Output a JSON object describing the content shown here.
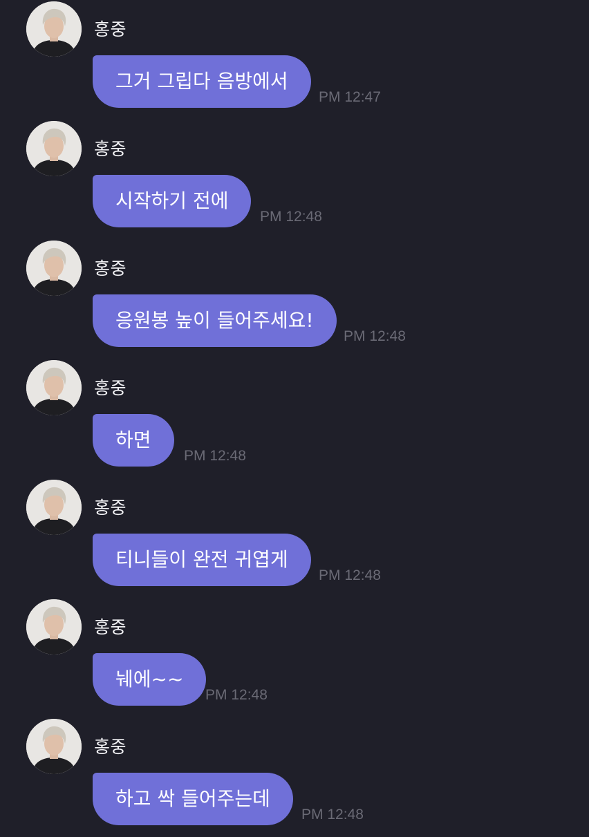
{
  "messages": [
    {
      "sender": "홍중",
      "text": "그거 그립다 음방에서",
      "time": "PM 12:47"
    },
    {
      "sender": "홍중",
      "text": "시작하기 전에",
      "time": "PM 12:48"
    },
    {
      "sender": "홍중",
      "text": "응원봉 높이 들어주세요!",
      "time": "PM 12:48"
    },
    {
      "sender": "홍중",
      "text": "하면",
      "time": "PM 12:48"
    },
    {
      "sender": "홍중",
      "text": "티니들이 완전 귀엽게",
      "time": "PM 12:48"
    },
    {
      "sender": "홍중",
      "text": "눼에~~",
      "time": "PM 12:48"
    },
    {
      "sender": "홍중",
      "text": "하고 싹 들어주는데",
      "time": "PM 12:48"
    }
  ],
  "colors": {
    "background": "#1f1f29",
    "bubble": "#7070d8",
    "timestamp": "#6a6a75",
    "sender_name": "#f2f2f5"
  },
  "icons": {
    "avatar": "profile-photo-avatar"
  }
}
